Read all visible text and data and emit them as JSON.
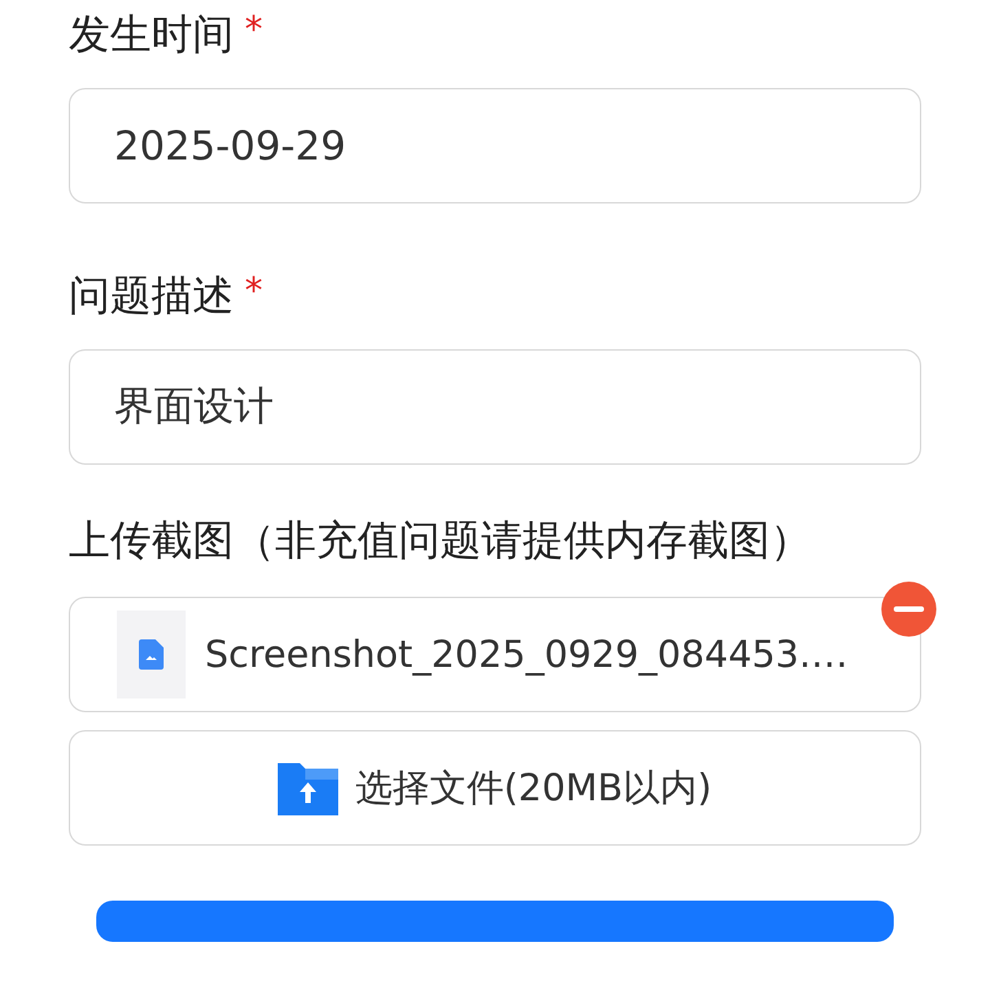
{
  "fields": [
    {
      "label": "发生时间",
      "required_mark": "*",
      "value": "2025-09-29"
    },
    {
      "label": "问题描述",
      "required_mark": "*",
      "value": "界面设计"
    }
  ],
  "upload": {
    "label": "上传截图（非充值问题请提供内存截图）",
    "files": [
      {
        "name": "Screenshot_2025_0929_084453.…"
      }
    ],
    "choose_button": "选择文件(20MB以内)"
  }
}
